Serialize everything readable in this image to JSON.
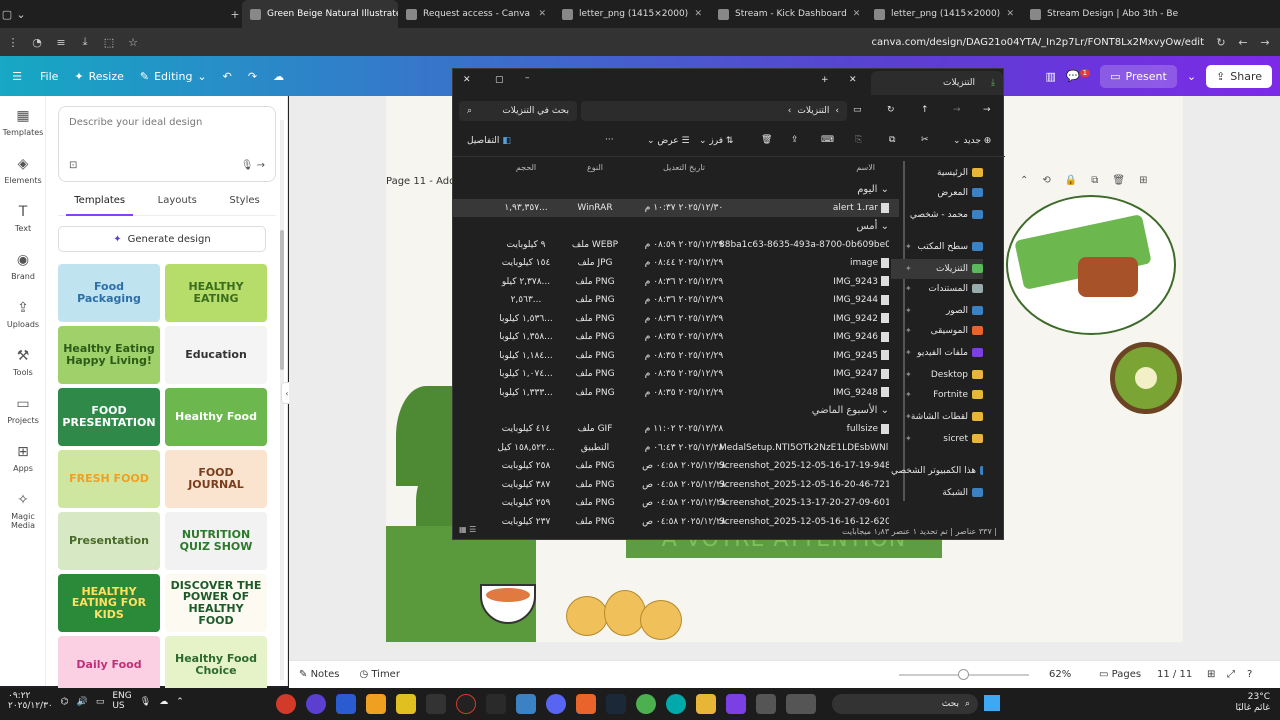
{
  "browser": {
    "tabs": [
      {
        "title": "Green Beige Natural Illustrated",
        "active": true
      },
      {
        "title": "Request access - Canva"
      },
      {
        "title": "letter_png (1415×2000)"
      },
      {
        "title": "Stream - Kick Dashboard"
      },
      {
        "title": "letter_png (1415×2000)"
      },
      {
        "title": "Stream Design | Abo 3th - Behance"
      }
    ],
    "url": "canva.com/design/DAG21o04YTA/_In2p7Lr/FONT8Lx2MxvyOw/edit"
  },
  "canva_top": {
    "file": "File",
    "resize": "Resize",
    "editing": "Editing",
    "present": "Present",
    "share": "Share",
    "notif_count": "1"
  },
  "rail": [
    "Templates",
    "Elements",
    "Text",
    "Brand",
    "Uploads",
    "Tools",
    "Projects",
    "Apps",
    "Magic Media"
  ],
  "panel": {
    "describe_placeholder": "Describe your ideal design",
    "tabs": [
      "Templates",
      "Layouts",
      "Styles"
    ],
    "generate": "Generate design",
    "thumbs": [
      {
        "text": "Food Packaging",
        "bg": "#bfe3ef",
        "fg": "#2f6fa8"
      },
      {
        "text": "HEALTHY EATING",
        "bg": "#b6dd6a",
        "fg": "#3a6d1e"
      },
      {
        "text": "Healthy Eating Happy Living!",
        "bg": "#9fd06a",
        "fg": "#2e5b18"
      },
      {
        "text": "Education",
        "bg": "#f4f4f4",
        "fg": "#333"
      },
      {
        "text": "FOOD PRESENTATION",
        "bg": "#2f8a4a",
        "fg": "#ffffff"
      },
      {
        "text": "Healthy Food",
        "bg": "#6cb84f",
        "fg": "#ffffff"
      },
      {
        "text": "FRESH FOOD",
        "bg": "#cfe6a1",
        "fg": "#f0a020"
      },
      {
        "text": "FOOD JOURNAL",
        "bg": "#fbe4cf",
        "fg": "#7a3d1e"
      },
      {
        "text": "Presentation",
        "bg": "#d7e9c4",
        "fg": "#4a6a2a"
      },
      {
        "text": "NUTRITION QUIZ SHOW",
        "bg": "#f2f2f2",
        "fg": "#2a7a2a"
      },
      {
        "text": "HEALTHY EATING FOR KIDS",
        "bg": "#2a8a3a",
        "fg": "#ffe060"
      },
      {
        "text": "DISCOVER THE POWER OF HEALTHY FOOD",
        "bg": "#fdfaf2",
        "fg": "#1d5a2a"
      },
      {
        "text": "Daily Food",
        "bg": "#fbd0e3",
        "fg": "#c0307a"
      },
      {
        "text": "Healthy Food Choice",
        "bg": "#e6f2c8",
        "fg": "#2e6a2e"
      }
    ]
  },
  "canvas": {
    "page_label": "Page 11 - Add",
    "banner_text": "A VOTRE ATTENTION"
  },
  "bottom": {
    "notes": "Notes",
    "timer": "Timer",
    "zoom": "62%",
    "pages_label": "Pages",
    "page_count": "11 / 11",
    "zoom_level": 0.45
  },
  "explorer": {
    "title": "التنزيلات",
    "search_placeholder": "بحث في التنزيلات",
    "breadcrumb": "التنزيلات",
    "cmd": {
      "new": "جديد",
      "sort": "فرز",
      "view": "عرض",
      "details": "التفاصيل"
    },
    "columns": {
      "name": "الاسم",
      "date": "تاريخ التعديل",
      "type": "النوع",
      "size": "الحجم"
    },
    "groups": [
      {
        "label": "اليوم",
        "files": [
          {
            "name": "alert 1.rar",
            "date": "٢٠٢٥/١٢/٣٠ ١٠:٣٧ م",
            "type": "WinRAR",
            "size": "١,٩٣,٣٥٧..."
          }
        ]
      },
      {
        "label": "أمس",
        "files": [
          {
            "name": "88ba1c63-8635-493a-8700-0b609be09676...",
            "date": "٢٠٢٥/١٢/٢٩ ٠٨:٥٩ م",
            "type": "ملف WEBP",
            "size": "٩ كيلوبايت"
          },
          {
            "name": "image",
            "date": "٢٠٢٥/١٢/٢٩ ٠٨:٤٤ م",
            "type": "ملف JPG",
            "size": "١٥٤ كيلوبايت"
          },
          {
            "name": "IMG_9243",
            "date": "٢٠٢٥/١٢/٢٩ ٠٨:٣٦ م",
            "type": "ملف PNG",
            "size": "٢,٣٧٨ كيلو..."
          },
          {
            "name": "IMG_9244",
            "date": "٢٠٢٥/١٢/٢٩ ٠٨:٣٦ م",
            "type": "ملف PNG",
            "size": "٢,٥٦٣..."
          },
          {
            "name": "IMG_9242",
            "date": "٢٠٢٥/١٢/٢٩ ٠٨:٣٦ م",
            "type": "ملف PNG",
            "size": "١,٥٣٦ كيلوبا..."
          },
          {
            "name": "IMG_9246",
            "date": "٢٠٢٥/١٢/٢٩ ٠٨:٣٥ م",
            "type": "ملف PNG",
            "size": "١,٣٥٨ كيلوبا..."
          },
          {
            "name": "IMG_9245",
            "date": "٢٠٢٥/١٢/٢٩ ٠٨:٣٥ م",
            "type": "ملف PNG",
            "size": "١,١٨٤ كيلوبا..."
          },
          {
            "name": "IMG_9247",
            "date": "٢٠٢٥/١٢/٢٩ ٠٨:٣٥ م",
            "type": "ملف PNG",
            "size": "١,٠٧٤ كيلوبا..."
          },
          {
            "name": "IMG_9248",
            "date": "٢٠٢٥/١٢/٢٩ ٠٨:٣٥ م",
            "type": "ملف PNG",
            "size": "١,٣٣٣ كيلوبا..."
          }
        ]
      },
      {
        "label": "الأسبوع الماضي",
        "files": [
          {
            "name": "fullsize",
            "date": "٢٠٢٥/١٢/٢٨ ١١:٠٢ م",
            "type": "ملف GIF",
            "size": "٤١٤ كيلوبايت"
          },
          {
            "name": "MedalSetup.NTI5OTk2NzE1LDEsbWNlbH...",
            "date": "٢٠٢٥/١٢/٢٨ ٠٦:٤٣ م",
            "type": "التطبيق",
            "size": "١٥٨,٥٢٢ كيل..."
          },
          {
            "name": "Screenshot_2025-12-05-16-17-19-948",
            "date": "٢٠٢٥/١٢/٢٨ ٠٤:٥٨ ص",
            "type": "ملف PNG",
            "size": "٢٥٨ كيلوبايت"
          },
          {
            "name": "Screenshot_2025-12-05-16-20-46-721",
            "date": "٢٠٢٥/١٢/٢٨ ٠٤:٥٨ ص",
            "type": "ملف PNG",
            "size": "٣٨٧ كيلوبايت"
          },
          {
            "name": "Screenshot_2025-13-17-20-27-09-601",
            "date": "٢٠٢٥/١٢/٢٨ ٠٤:٥٨ ص",
            "type": "ملف PNG",
            "size": "٢٥٩ كيلوبايت"
          },
          {
            "name": "Screenshot_2025-12-05-16-16-12-620",
            "date": "٢٠٢٥/١٢/٢٨ ٠٤:٥٨ ص",
            "type": "ملف PNG",
            "size": "٢٣٧ كيلوبايت"
          }
        ]
      }
    ],
    "sidebar": [
      {
        "label": "الرئيسية",
        "icon": "home-icon"
      },
      {
        "label": "المعرض",
        "icon": "gallery-icon"
      },
      {
        "label": "محمد - شخصي",
        "icon": "cloud-icon"
      },
      {
        "label": "سطح المكتب",
        "icon": "desktop-icon"
      },
      {
        "label": "التنزيلات",
        "icon": "download-icon",
        "selected": true
      },
      {
        "label": "المستندات",
        "icon": "documents-icon"
      },
      {
        "label": "الصور",
        "icon": "pictures-icon"
      },
      {
        "label": "الموسيقى",
        "icon": "music-icon"
      },
      {
        "label": "ملفات الفيديو",
        "icon": "video-icon"
      },
      {
        "label": "Desktop",
        "icon": "folder-icon"
      },
      {
        "label": "Fortnite",
        "icon": "folder-icon"
      },
      {
        "label": "لقطات الشاشة",
        "icon": "folder-icon"
      },
      {
        "label": "sicret",
        "icon": "folder-icon"
      },
      {
        "label": "هذا الكمبيوتر الشخصي",
        "icon": "pc-icon"
      },
      {
        "label": "الشبكة",
        "icon": "network-icon"
      }
    ],
    "status": "٣٣٧ عناصر | تم تحديد ١ عنصر ١٫٨٣ ميجابايت |"
  },
  "taskbar": {
    "search": "بحث",
    "lang": "ENG",
    "region": "US",
    "time": "٠٩:٢٢",
    "date": "٢٠٢٥/١٢/٣٠",
    "temp": "23°C",
    "weather": "غائم غالبًا"
  }
}
